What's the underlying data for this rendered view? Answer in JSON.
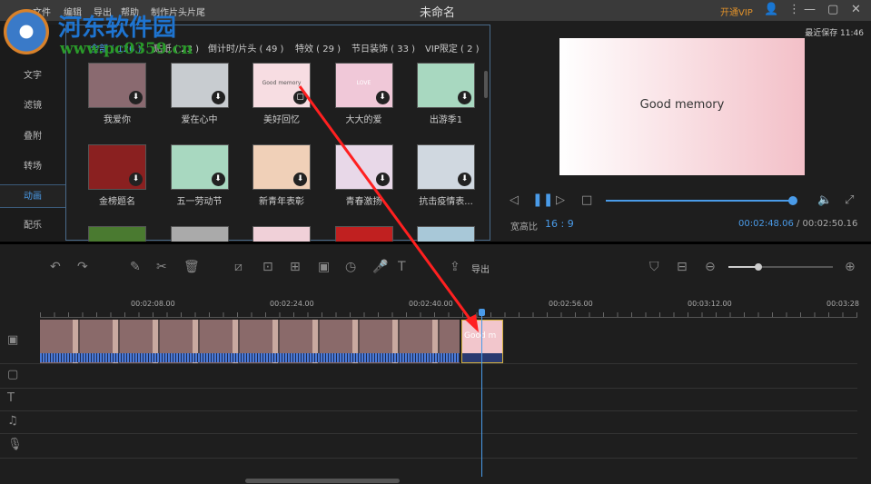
{
  "watermark": {
    "name": "河东软件园",
    "url": "www.pc0359.cn"
  },
  "menu": [
    "文件",
    "编辑",
    "导出",
    "帮助",
    "制作片头片尾"
  ],
  "title": "未命名",
  "vip": "开通VIP",
  "window_buttons": [
    "user-icon",
    "more-icon",
    "minimize-icon",
    "maximize-icon",
    "close-icon"
  ],
  "sidebar": [
    {
      "label": "文字"
    },
    {
      "label": "滤镜"
    },
    {
      "label": "叠附"
    },
    {
      "label": "转场"
    },
    {
      "label": "动画",
      "active": true
    },
    {
      "label": "配乐"
    }
  ],
  "library": {
    "categories": [
      "全部 ( 126 )",
      "贴纸 ( 23 )",
      "倒计时/片头 ( 49 )",
      "特效 ( 29 )",
      "节日装饰 ( 33 )",
      "VIP限定 ( 2 )"
    ],
    "items": [
      {
        "label": "我爱你",
        "color": "#8a6a70"
      },
      {
        "label": "爱在心中",
        "color": "#c8ccd0"
      },
      {
        "label": "美好回忆",
        "color": "#f7dde2",
        "thumb_text": "Good memory"
      },
      {
        "label": "大大的爱",
        "color": "#f0c8d8",
        "thumb_text": "LOVE"
      },
      {
        "label": "出游季1",
        "color": "#a8d8c0"
      },
      {
        "label": "金榜题名",
        "color": "#8a2020"
      },
      {
        "label": "五一劳动节",
        "color": "#a8d8c0"
      },
      {
        "label": "新青年表彰",
        "color": "#f0d0b8"
      },
      {
        "label": "青春激扬",
        "color": "#e8d8e8"
      },
      {
        "label": "抗击疫情表...",
        "color": "#d0d8e0"
      },
      {
        "label": "",
        "color": "#4a7a30"
      },
      {
        "label": "",
        "color": "#aaa"
      },
      {
        "label": "",
        "color": "#f0d0d8"
      },
      {
        "label": "",
        "color": "#c02020"
      },
      {
        "label": "",
        "color": "#a8c8d8"
      }
    ]
  },
  "preview": {
    "saved": "最近保存 11:46",
    "text": "Good memory",
    "aspect_label": "宽高比",
    "aspect": "16 : 9",
    "current": "00:02:48.06",
    "total": "/ 00:02:50.16",
    "progress": 0.99
  },
  "toolbar": {
    "export": "导出",
    "zoom": 0.2
  },
  "timeline": {
    "ticks": [
      "00:02:08.00",
      "00:02:24.00",
      "00:02:40.00",
      "00:02:56.00",
      "00:03:12.00",
      "00:03:28"
    ],
    "clip_title": "Good m",
    "accent": "#4a9be8"
  }
}
